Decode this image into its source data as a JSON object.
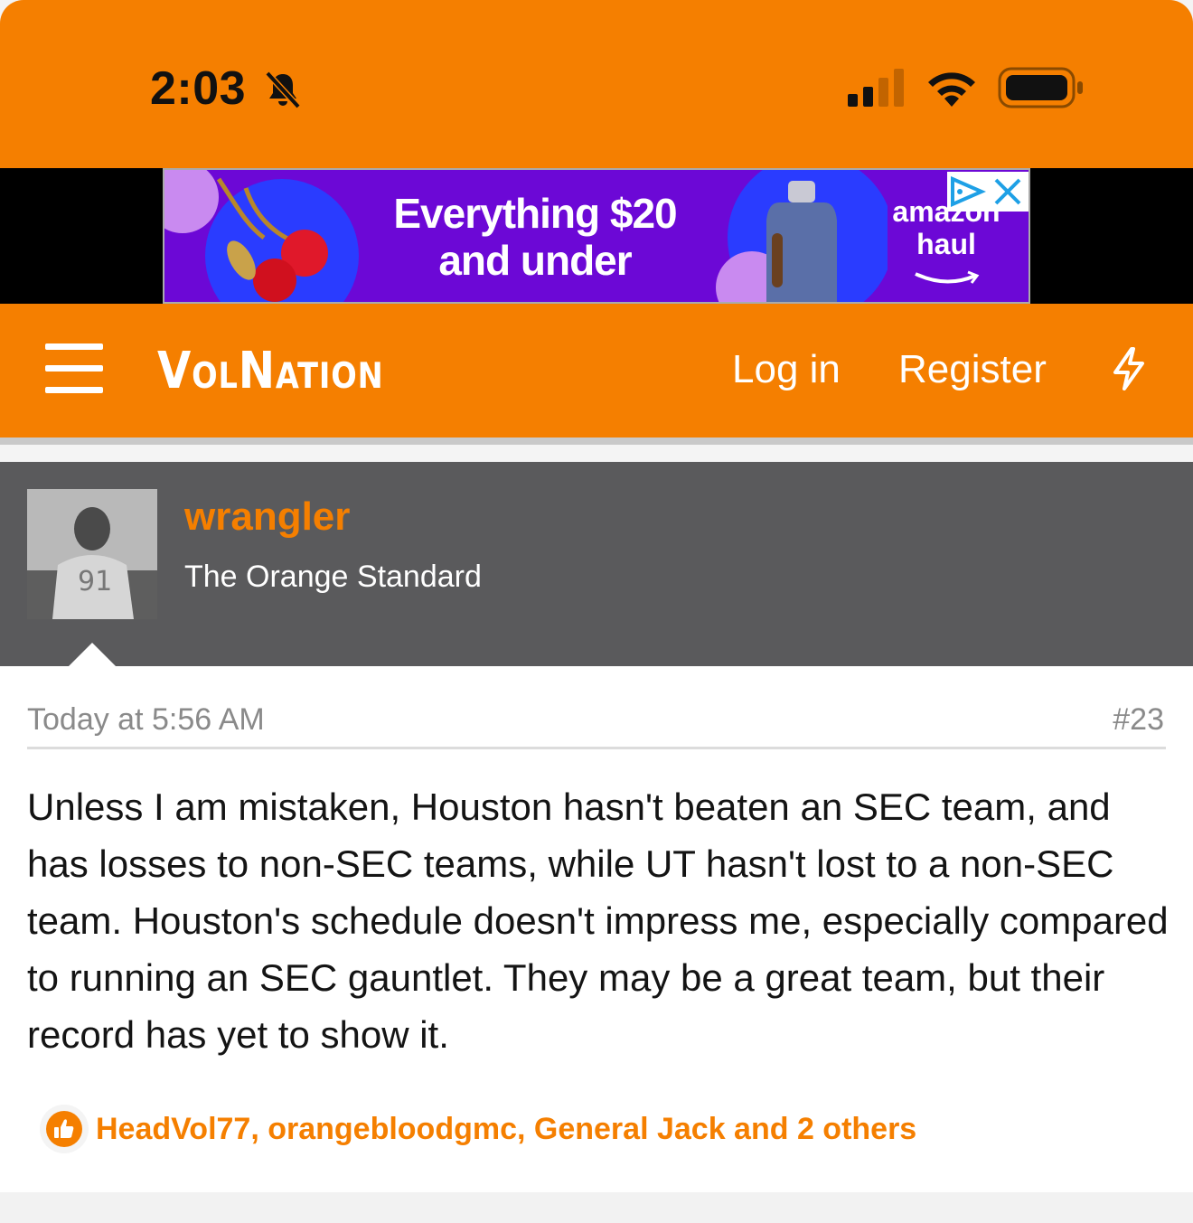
{
  "status_bar": {
    "time": "2:03",
    "bell_icon": "bell-slash-icon",
    "signal_icon": "cellular-signal-icon",
    "wifi_icon": "wifi-icon",
    "battery_icon": "battery-icon"
  },
  "ad": {
    "headline_line1": "Everything $20",
    "headline_line2": "and under",
    "brand_line1": "amazon",
    "brand_line2": "haul",
    "bg_color": "#6c08d6"
  },
  "nav": {
    "logo": "VolNation",
    "login": "Log in",
    "register": "Register",
    "menu_icon": "hamburger-menu-icon",
    "whats_new_icon": "lightning-bolt-icon",
    "accent": "#f57f00"
  },
  "post": {
    "username": "wrangler",
    "user_title": "The Orange Standard",
    "timestamp": "Today at 5:56 AM",
    "post_number": "#23",
    "body": "Unless I am mistaken, Houston hasn't beaten an SEC team, and has losses to non-SEC teams, while UT hasn't lost to a non-SEC team. Houston's schedule doesn't impress me, especially compared to running an SEC gauntlet. They may be a great team, but their record has yet to show it.",
    "reactions": "HeadVol77, orangebloodgmc, General Jack and 2 others",
    "reaction_icon": "thumbs-up-icon"
  }
}
